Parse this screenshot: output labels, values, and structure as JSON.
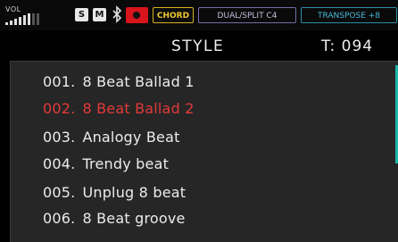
{
  "status_bar": {
    "vol_label": "VOL",
    "volume_level": 0.6,
    "s_badge": "S",
    "m_badge": "M",
    "bluetooth_icon": "bluetooth-icon",
    "record_icon": "record-icon",
    "chord_label": "CHORD",
    "dual_split_label": "DUAL/SPLIT C4",
    "transpose_label": "TRANSPOSE +8"
  },
  "header": {
    "title": "STYLE",
    "tempo": "T: 094"
  },
  "style_list": {
    "items": [
      {
        "number": "001.",
        "name": "8 Beat Ballad 1",
        "selected": false
      },
      {
        "number": "002.",
        "name": "8 Beat Ballad 2",
        "selected": true
      },
      {
        "number": "003.",
        "name": "Analogy Beat",
        "selected": false
      },
      {
        "number": "004.",
        "name": "Trendy beat",
        "selected": false
      },
      {
        "number": "005.",
        "name": "Unplug 8 beat",
        "selected": false
      },
      {
        "number": "006.",
        "name": "8 Beat groove",
        "selected": false
      }
    ]
  },
  "colors": {
    "selected_text": "#e33a3a",
    "chord_accent": "#f0c830",
    "transpose_accent": "#47b8d6",
    "scroll_thumb": "#1cb5a8",
    "record": "#d8141c"
  }
}
